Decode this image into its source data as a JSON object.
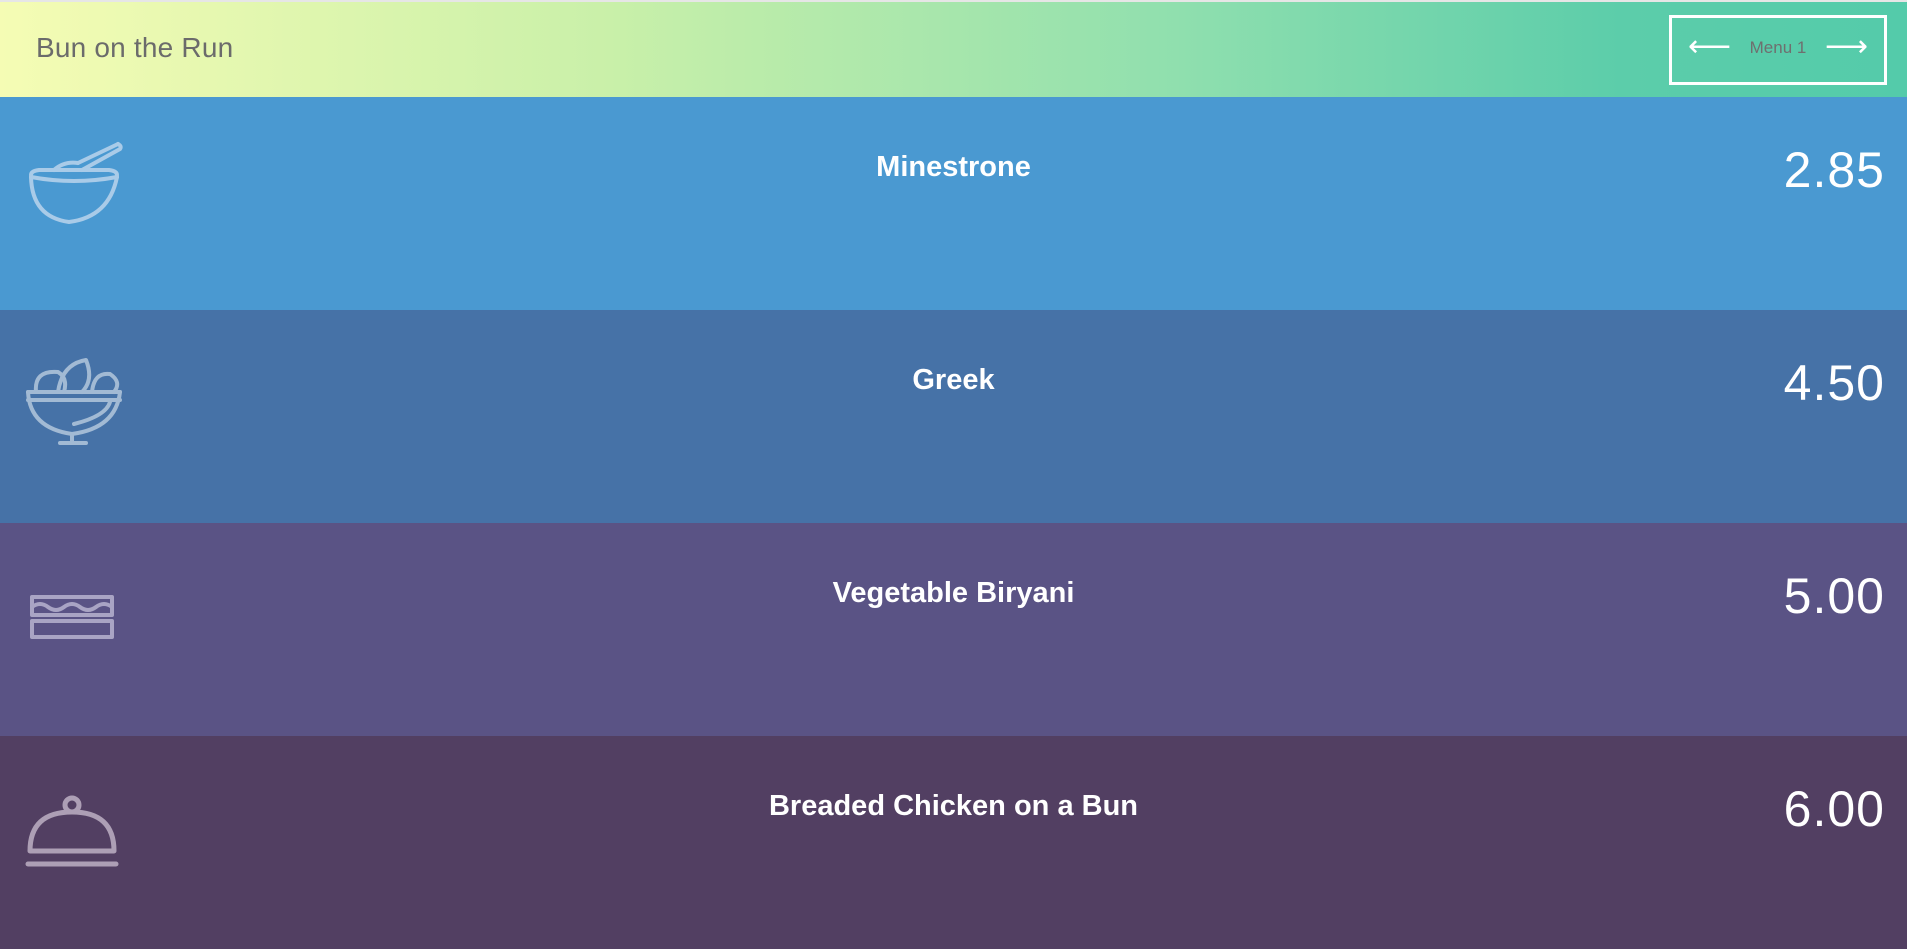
{
  "header": {
    "brand": "Bun on the Run",
    "menu_label": "Menu 1",
    "prev_arrow": "⟵",
    "next_arrow": "⟶"
  },
  "items": [
    {
      "name": "Minestrone",
      "price": "2.85",
      "icon": "soup-bowl-icon",
      "color": "#4a99d1"
    },
    {
      "name": "Greek",
      "price": "4.50",
      "icon": "salad-bowl-icon",
      "color": "#4672a7"
    },
    {
      "name": "Vegetable Biryani",
      "price": "5.00",
      "icon": "sandwich-icon",
      "color": "#5a5385"
    },
    {
      "name": "Breaded Chicken on a Bun",
      "price": "6.00",
      "icon": "cloche-icon",
      "color": "#523f62"
    }
  ],
  "colors": {
    "header_gradient_start": "#f5fcb4",
    "header_gradient_end": "#54cbaa",
    "icon_stroke": "#b3cde6"
  }
}
